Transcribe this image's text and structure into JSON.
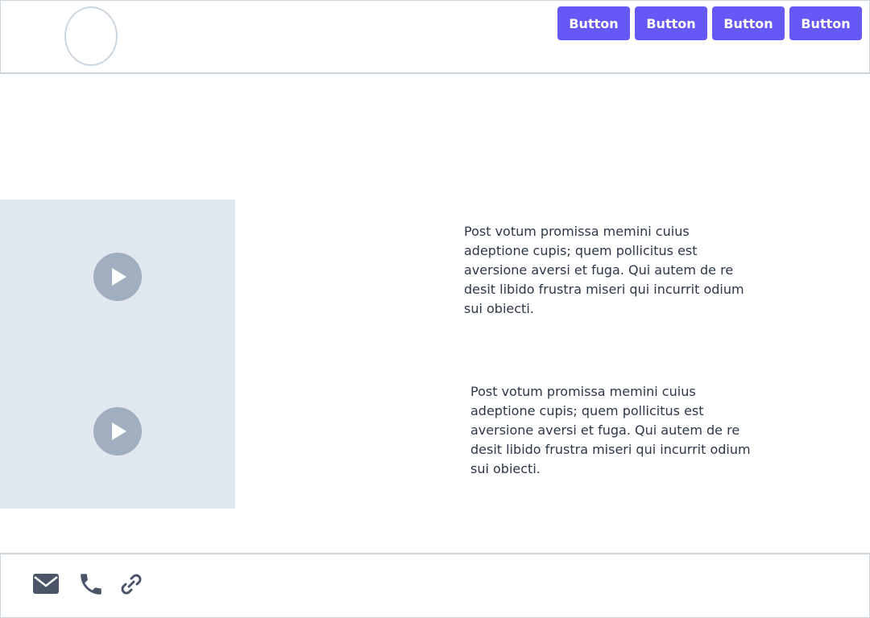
{
  "header": {
    "logo_icon": "circle-logo",
    "nav": [
      {
        "label": "Button"
      },
      {
        "label": "Button"
      },
      {
        "label": "Button"
      },
      {
        "label": "Button"
      }
    ]
  },
  "media": {
    "items": [
      {
        "icon": "play-icon"
      },
      {
        "icon": "play-icon"
      }
    ]
  },
  "content": {
    "paragraphs": [
      {
        "text": "Post votum promissa memini cuius adeptione cupis; quem pollicitus est aversione aversi et fuga. Qui autem de re desit libido frustra miseri qui incurrit odium sui obiecti."
      },
      {
        "text": "Post votum promissa memini cuius adeptione cupis; quem pollicitus est aversione aversi et fuga. Qui autem de re desit libido frustra miseri qui incurrit odium sui obiecti."
      }
    ]
  },
  "footer": {
    "icons": [
      "mail-icon",
      "phone-icon",
      "link-icon"
    ]
  },
  "colors": {
    "accent": "#6658f6",
    "border": "#cbd5e0",
    "panel": "#e2e8f0",
    "play": "#a0aec0",
    "text": "#2d3748",
    "icon": "#4a5568"
  }
}
